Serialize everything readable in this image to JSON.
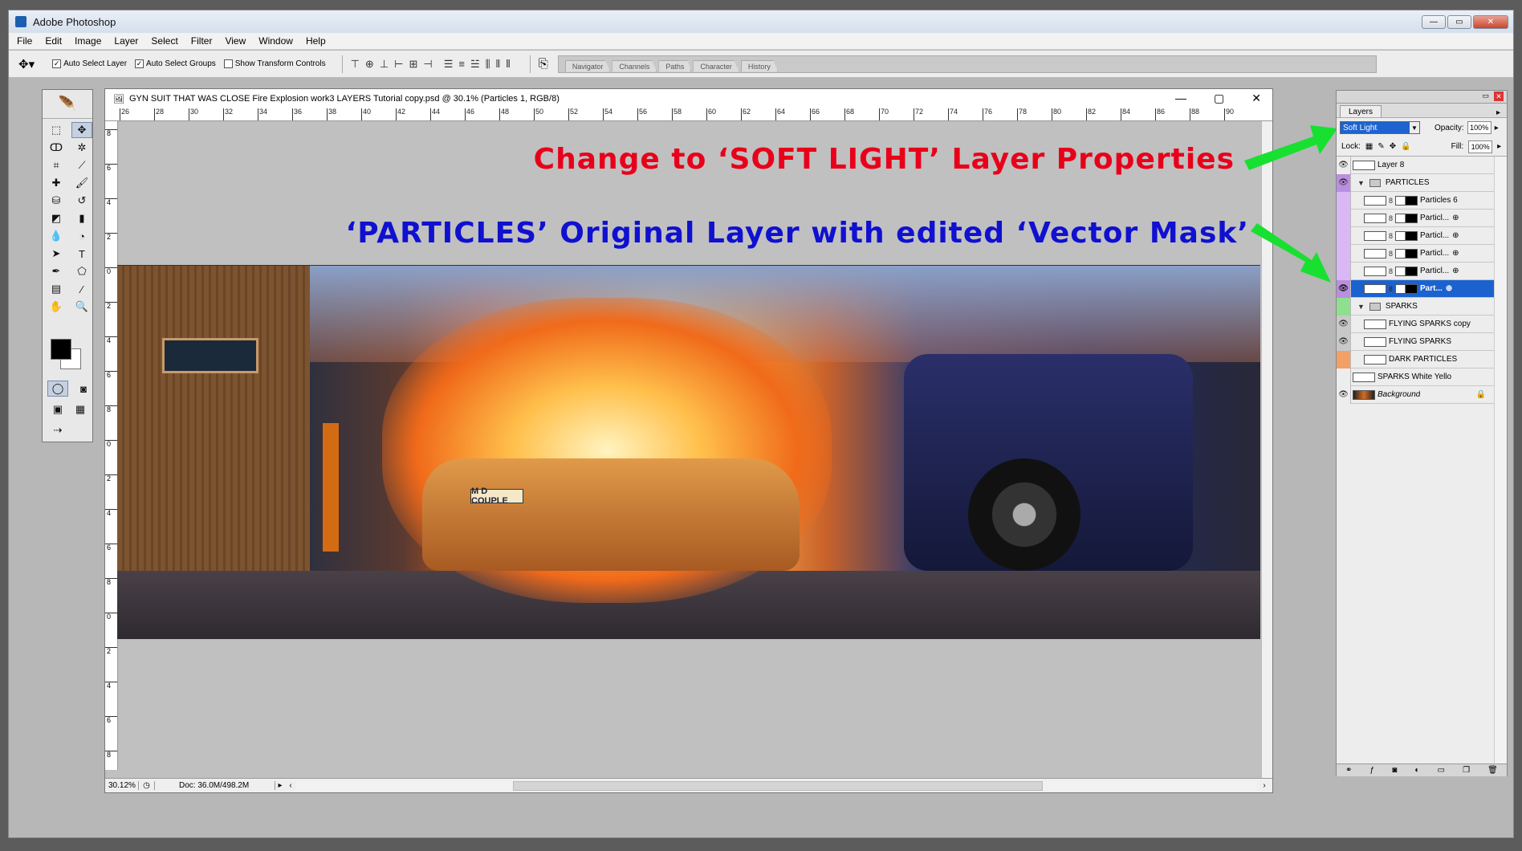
{
  "app": {
    "title": "Adobe Photoshop",
    "window_buttons": [
      "—",
      "▭",
      "✕"
    ]
  },
  "menu": [
    "File",
    "Edit",
    "Image",
    "Layer",
    "Select",
    "Filter",
    "View",
    "Window",
    "Help"
  ],
  "options": {
    "auto_select_layer": "Auto Select Layer",
    "auto_select_groups": "Auto Select Groups",
    "show_transform": "Show Transform Controls",
    "palette_tabs": [
      "Navigator",
      "Channels",
      "Paths",
      "Character",
      "History"
    ]
  },
  "document": {
    "title": "GYN SUIT THAT WAS CLOSE Fire Explosion work3 LAYERS Tutorial copy.psd @ 30.1% (Particles 1, RGB/8)",
    "ruler_top": [
      "26",
      "28",
      "30",
      "32",
      "34",
      "36",
      "38",
      "40",
      "42",
      "44",
      "46",
      "48",
      "50",
      "52",
      "54",
      "56",
      "58",
      "60",
      "62",
      "64",
      "66",
      "68",
      "70",
      "72",
      "74",
      "76",
      "78",
      "80",
      "82",
      "84",
      "86",
      "88",
      "90"
    ],
    "ruler_left": [
      "8",
      "6",
      "4",
      "2",
      "0",
      "2",
      "4",
      "6",
      "8",
      "0",
      "2",
      "4",
      "6",
      "8",
      "0",
      "2",
      "4",
      "6",
      "8"
    ],
    "zoom": "30.12%",
    "doc_size": "Doc: 36.0M/498.2M",
    "plate": "M D COUPLE"
  },
  "annotations": {
    "line1": "Change to ‘SOFT LIGHT’ Layer Properties",
    "line2": "‘PARTICLES’ Original Layer with edited ‘Vector Mask’",
    "line1_color": "#e8001a",
    "line2_color": "#1010d0",
    "arrow_color": "#18e030"
  },
  "layers_panel": {
    "tab": "Layers",
    "blend_mode": "Soft Light",
    "opacity_label": "Opacity:",
    "opacity": "100%",
    "lock_label": "Lock:",
    "fill_label": "Fill:",
    "fill": "100%",
    "layers": [
      {
        "name": "Layer 8",
        "visible": true,
        "color": "",
        "type": "layer"
      },
      {
        "name": "PARTICLES",
        "visible": true,
        "color": "#b98fe0",
        "type": "group"
      },
      {
        "name": "Particles 6",
        "visible": false,
        "color": "#d9b8f5",
        "type": "masked"
      },
      {
        "name": "Particl...",
        "visible": false,
        "color": "#d9b8f5",
        "type": "masked"
      },
      {
        "name": "Particl...",
        "visible": false,
        "color": "#d9b8f5",
        "type": "masked"
      },
      {
        "name": "Particl...",
        "visible": false,
        "color": "#d9b8f5",
        "type": "masked"
      },
      {
        "name": "Particl...",
        "visible": false,
        "color": "#d9b8f5",
        "type": "masked"
      },
      {
        "name": "Part...",
        "visible": true,
        "color": "#b98fe0",
        "type": "masked",
        "selected": true
      },
      {
        "name": "SPARKS",
        "visible": false,
        "color": "#8ee08e",
        "type": "group"
      },
      {
        "name": "FLYING SPARKS copy",
        "visible": true,
        "color": "#c8c8c8",
        "type": "layer"
      },
      {
        "name": "FLYING SPARKS",
        "visible": true,
        "color": "#c8c8c8",
        "type": "layer"
      },
      {
        "name": "DARK PARTICLES",
        "visible": false,
        "color": "#f3a067",
        "type": "layer"
      },
      {
        "name": "SPARKS White Yello",
        "visible": false,
        "color": "",
        "type": "layer"
      },
      {
        "name": "Background",
        "visible": true,
        "color": "",
        "type": "background"
      }
    ],
    "footer_icons": [
      "link-icon",
      "fx-icon",
      "mask-icon",
      "adjustment-icon",
      "group-icon",
      "new-layer-icon",
      "trash-icon"
    ]
  }
}
